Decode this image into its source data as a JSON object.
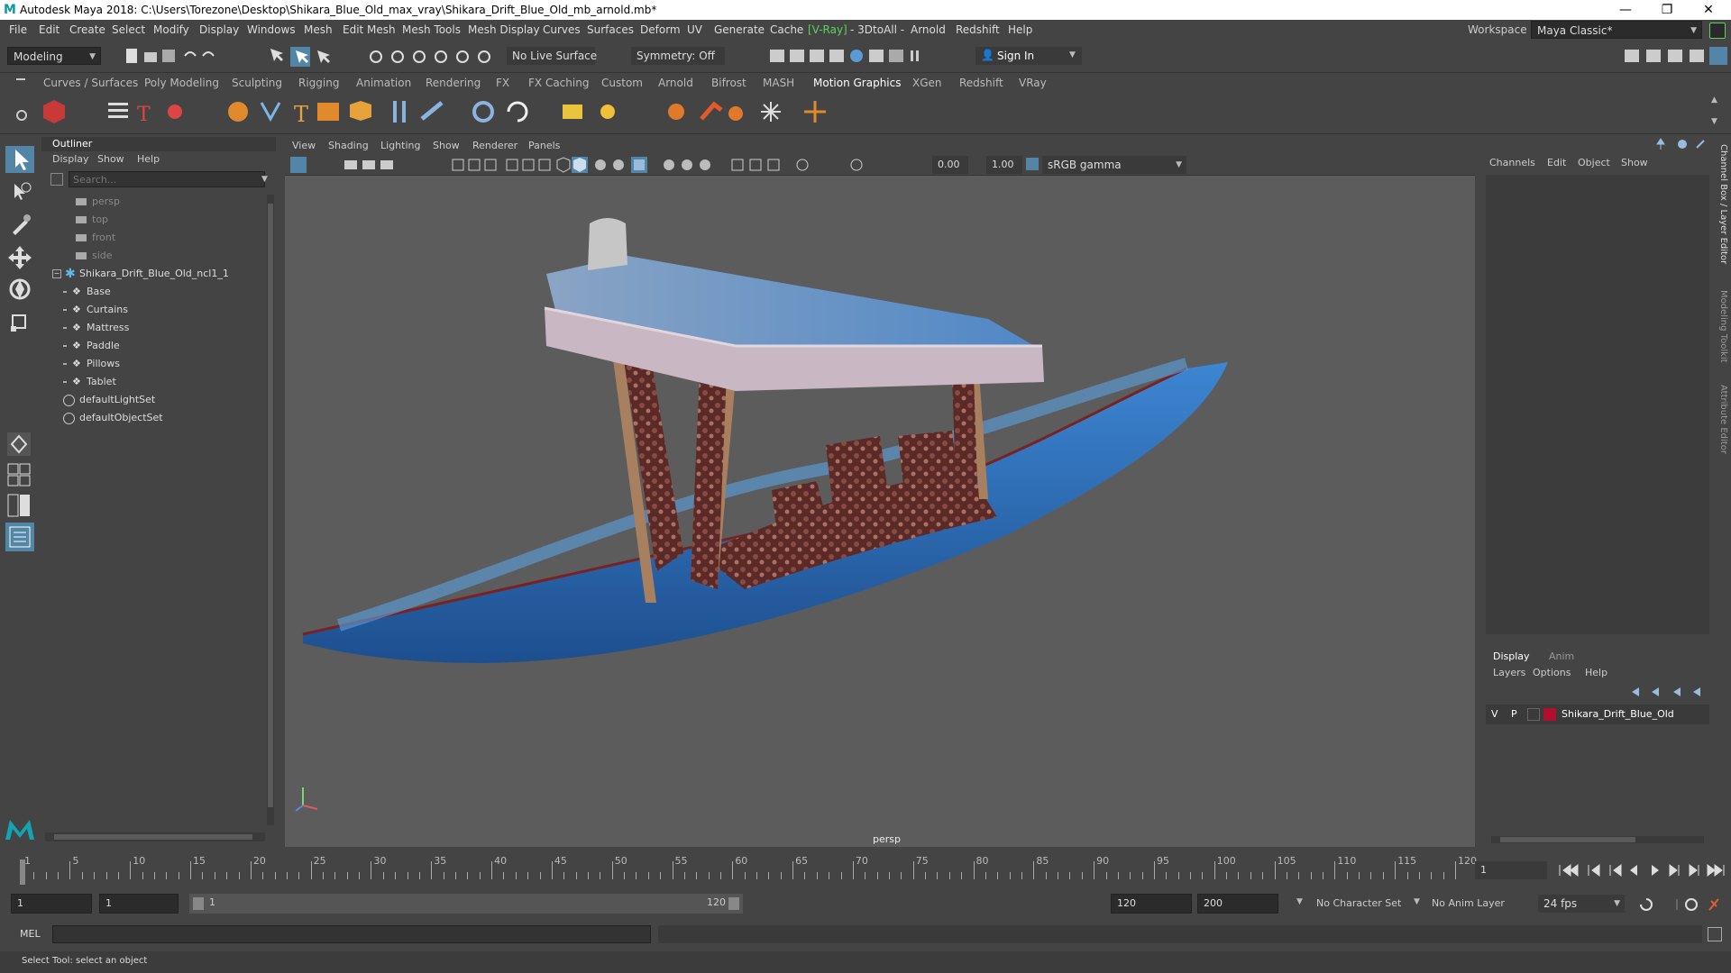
{
  "window": {
    "title": "Autodesk Maya 2018: C:\\Users\\Torezone\\Desktop\\Shikara_Blue_Old_max_vray\\Shikara_Drift_Blue_Old_mb_arnold.mb*",
    "minimize": "—",
    "restore": "❐",
    "close": "✕"
  },
  "menubar": {
    "items": [
      "File",
      "Edit",
      "Create",
      "Select",
      "Modify",
      "Display",
      "Windows",
      "Mesh",
      "Edit Mesh",
      "Mesh Tools",
      "Mesh Display",
      "Curves",
      "Surfaces",
      "Deform",
      "UV",
      "Generate",
      "Cache",
      "[V-Ray]",
      "- 3DtoAll -",
      "Arnold",
      "Redshift",
      "Help"
    ],
    "workspace_label": "Workspace :",
    "workspace_value": "Maya Classic*"
  },
  "statusline": {
    "mode": "Modeling",
    "live_surface": "No Live Surface",
    "symmetry": "Symmetry: Off",
    "sign_in": "Sign In"
  },
  "shelf": {
    "tabs": [
      "Curves / Surfaces",
      "Poly Modeling",
      "Sculpting",
      "Rigging",
      "Animation",
      "Rendering",
      "FX",
      "FX Caching",
      "Custom",
      "Arnold",
      "Bifrost",
      "MASH",
      "Motion Graphics",
      "XGen",
      "Redshift",
      "VRay"
    ],
    "active_tab": "Motion Graphics"
  },
  "outliner": {
    "title": "Outliner",
    "menu": [
      "Display",
      "Show",
      "Help"
    ],
    "search_placeholder": "Search...",
    "cameras": [
      "persp",
      "top",
      "front",
      "side"
    ],
    "root": "Shikara_Drift_Blue_Old_ncl1_1",
    "children": [
      "Base",
      "Curtains",
      "Mattress",
      "Paddle",
      "Pillows",
      "Tablet"
    ],
    "sets": [
      "defaultLightSet",
      "defaultObjectSet"
    ]
  },
  "viewport": {
    "menu": [
      "View",
      "Shading",
      "Lighting",
      "Show",
      "Renderer",
      "Panels"
    ],
    "exposure": "0.00",
    "gamma": "1.00",
    "colorspace": "sRGB gamma",
    "camera_label": "persp"
  },
  "channelbox": {
    "menu": [
      "Channels",
      "Edit",
      "Object",
      "Show"
    ],
    "side_tabs": [
      "Channel Box / Layer Editor",
      "Modeling Toolkit",
      "Attribute Editor"
    ]
  },
  "layereditor": {
    "tabs": [
      "Display",
      "Anim"
    ],
    "menu": [
      "Layers",
      "Options",
      "Help"
    ],
    "layer": {
      "v": "V",
      "p": "P",
      "name": "Shikara_Drift_Blue_Old",
      "color": "#b0102c"
    }
  },
  "timeline": {
    "ticks": [
      "1",
      "5",
      "10",
      "15",
      "20",
      "25",
      "30",
      "35",
      "40",
      "45",
      "50",
      "55",
      "60",
      "65",
      "70",
      "75",
      "80",
      "85",
      "90",
      "95",
      "100",
      "105",
      "110",
      "115",
      "120"
    ],
    "current_frame": "1"
  },
  "range": {
    "start": "1",
    "playback_start": "1",
    "slider_start": "1",
    "slider_end": "120",
    "playback_end": "120",
    "end": "200",
    "character_set": "No Character Set",
    "anim_layer": "No Anim Layer",
    "fps": "24 fps"
  },
  "cmdline": {
    "label": "MEL"
  },
  "helpline": {
    "text": "Select Tool: select an object"
  },
  "colors": {
    "accent": "#5285a6",
    "vray_green": "#5cd35c",
    "boat_blue": "#2e6fb8"
  }
}
